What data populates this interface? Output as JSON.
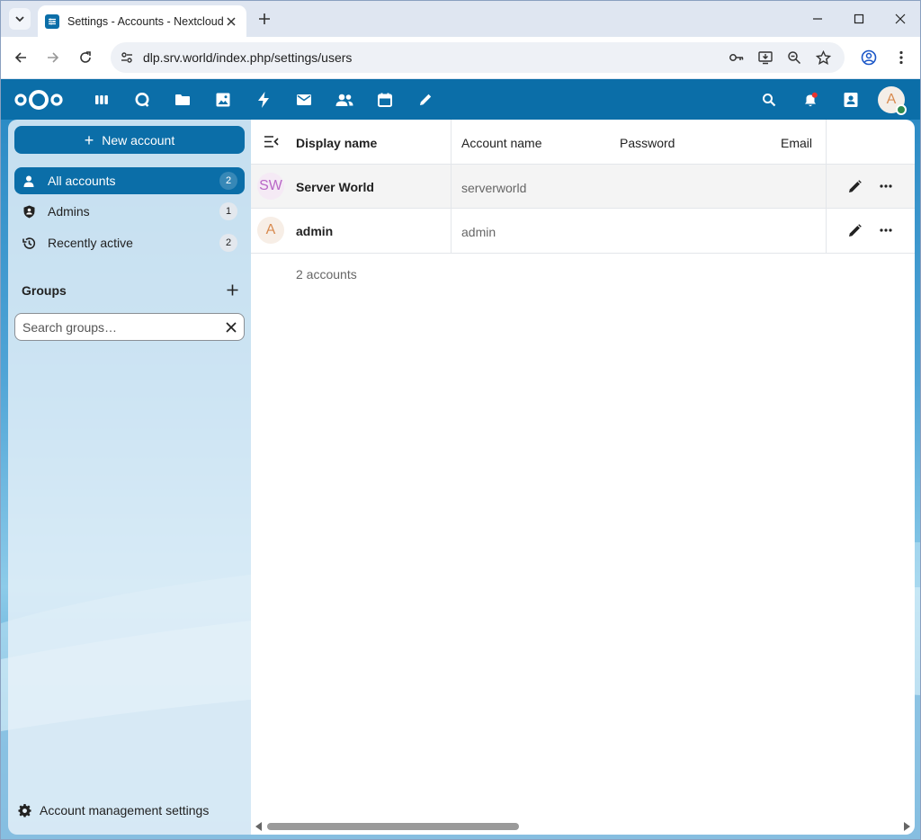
{
  "browser": {
    "tab_title": "Settings - Accounts - Nextcloud",
    "url": "dlp.srv.world/index.php/settings/users"
  },
  "header": {
    "apps": [
      "dashboard-icon",
      "talk-icon",
      "files-icon",
      "photos-icon",
      "activity-icon",
      "mail-icon",
      "contacts-icon",
      "calendar-icon",
      "notes-icon"
    ],
    "user_initial": "A",
    "accent_color": "#0b6ea8"
  },
  "sidebar": {
    "new_account_label": "New account",
    "items": [
      {
        "label": "All accounts",
        "count": "2",
        "icon": "user-icon"
      },
      {
        "label": "Admins",
        "count": "1",
        "icon": "shield-icon"
      },
      {
        "label": "Recently active",
        "count": "2",
        "icon": "history-icon"
      }
    ],
    "groups_heading": "Groups",
    "search_placeholder": "Search groups…",
    "settings_label": "Account management settings"
  },
  "table": {
    "headers": {
      "display_name": "Display name",
      "account_name": "Account name",
      "password": "Password",
      "email": "Email"
    },
    "rows": [
      {
        "initials": "SW",
        "display_name": "Server World",
        "account_name": "serverworld",
        "avatar_bg": "#f5eaf5",
        "avatar_fg": "#b968c7"
      },
      {
        "initials": "A",
        "display_name": "admin",
        "account_name": "admin",
        "avatar_bg": "#f7eee6",
        "avatar_fg": "#d88a4f"
      }
    ],
    "footer": "2 accounts"
  }
}
